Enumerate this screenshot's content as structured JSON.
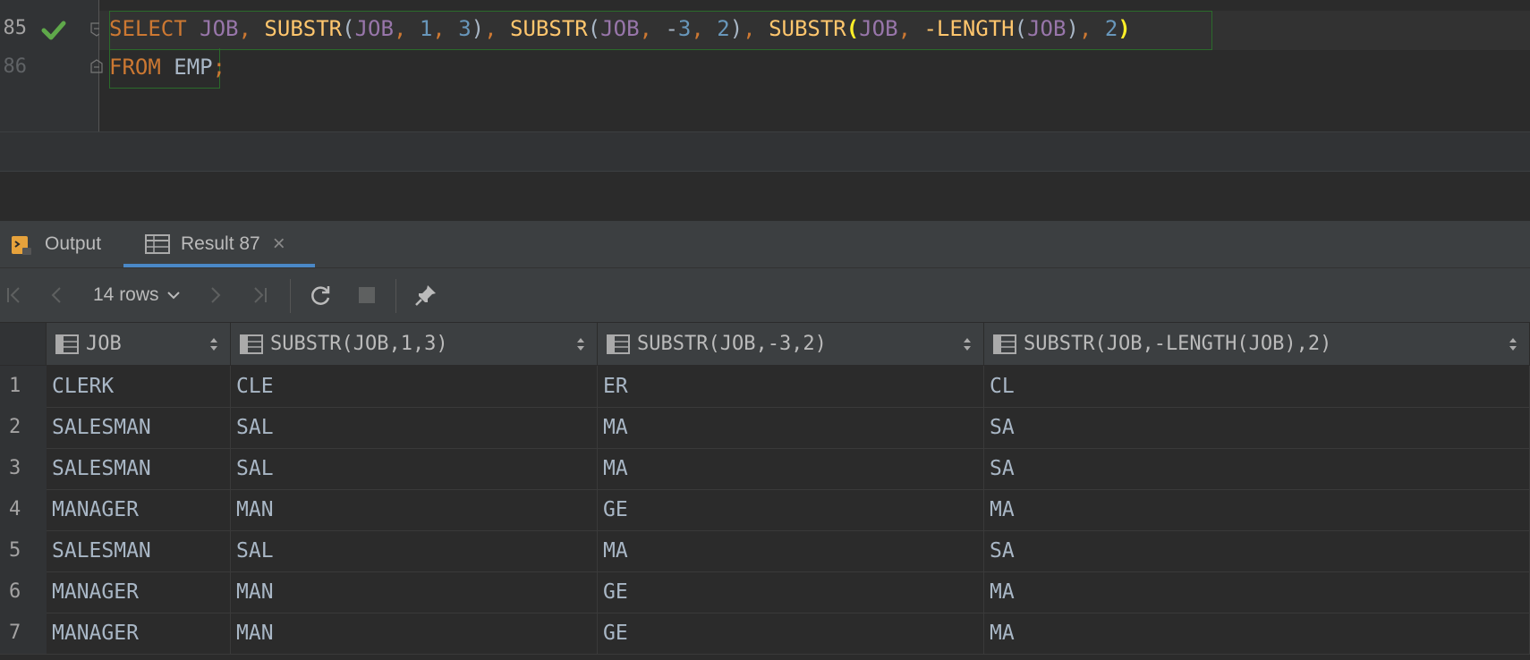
{
  "editor": {
    "line_numbers": [
      "85",
      "86"
    ],
    "line1_tokens": [
      {
        "t": "SELECT",
        "c": "kw"
      },
      {
        "t": " ",
        "c": "plain"
      },
      {
        "t": "JOB",
        "c": "col"
      },
      {
        "t": ", ",
        "c": "punc"
      },
      {
        "t": "SUBSTR",
        "c": "fn"
      },
      {
        "t": "(",
        "c": "plain"
      },
      {
        "t": "JOB",
        "c": "col"
      },
      {
        "t": ", ",
        "c": "punc"
      },
      {
        "t": "1",
        "c": "num"
      },
      {
        "t": ", ",
        "c": "punc"
      },
      {
        "t": "3",
        "c": "num"
      },
      {
        "t": ")",
        "c": "plain"
      },
      {
        "t": ", ",
        "c": "punc"
      },
      {
        "t": "SUBSTR",
        "c": "fn"
      },
      {
        "t": "(",
        "c": "plain"
      },
      {
        "t": "JOB",
        "c": "col"
      },
      {
        "t": ", ",
        "c": "punc"
      },
      {
        "t": "-",
        "c": "plain"
      },
      {
        "t": "3",
        "c": "num"
      },
      {
        "t": ", ",
        "c": "punc"
      },
      {
        "t": "2",
        "c": "num"
      },
      {
        "t": ")",
        "c": "plain"
      },
      {
        "t": ", ",
        "c": "punc"
      },
      {
        "t": "SUBSTR",
        "c": "fn"
      },
      {
        "t": "(",
        "c": "brace"
      },
      {
        "t": "JOB",
        "c": "col"
      },
      {
        "t": ", ",
        "c": "punc"
      },
      {
        "t": "-LENGTH",
        "c": "fn"
      },
      {
        "t": "(",
        "c": "plain"
      },
      {
        "t": "JOB",
        "c": "col"
      },
      {
        "t": ")",
        "c": "plain"
      },
      {
        "t": ", ",
        "c": "punc"
      },
      {
        "t": "2",
        "c": "num"
      },
      {
        "t": ")",
        "c": "brace"
      }
    ],
    "line2_tokens": [
      {
        "t": "FROM",
        "c": "kw"
      },
      {
        "t": " ",
        "c": "plain"
      },
      {
        "t": "EMP",
        "c": "plain"
      },
      {
        "t": ";",
        "c": "punc"
      }
    ]
  },
  "tabs": [
    {
      "label": "Output",
      "icon": "output-icon"
    },
    {
      "label": "Result 87",
      "icon": "table-icon",
      "active": true
    }
  ],
  "toolbar": {
    "rows_label": "14 rows"
  },
  "grid": {
    "columns": [
      "JOB",
      "SUBSTR(JOB,1,3)",
      "SUBSTR(JOB,-3,2)",
      "SUBSTR(JOB,-LENGTH(JOB),2)"
    ],
    "rows": [
      {
        "n": "1",
        "cells": [
          "CLERK",
          "CLE",
          "ER",
          "CL"
        ]
      },
      {
        "n": "2",
        "cells": [
          "SALESMAN",
          "SAL",
          "MA",
          "SA"
        ]
      },
      {
        "n": "3",
        "cells": [
          "SALESMAN",
          "SAL",
          "MA",
          "SA"
        ]
      },
      {
        "n": "4",
        "cells": [
          "MANAGER",
          "MAN",
          "GE",
          "MA"
        ]
      },
      {
        "n": "5",
        "cells": [
          "SALESMAN",
          "SAL",
          "MA",
          "SA"
        ]
      },
      {
        "n": "6",
        "cells": [
          "MANAGER",
          "MAN",
          "GE",
          "MA"
        ]
      },
      {
        "n": "7",
        "cells": [
          "MANAGER",
          "MAN",
          "GE",
          "MA"
        ]
      }
    ]
  },
  "colors": {
    "keyword": "#cc7832",
    "function": "#ffc66d",
    "column": "#9876aa",
    "number": "#6897bb",
    "success_check": "#5fa84a"
  }
}
